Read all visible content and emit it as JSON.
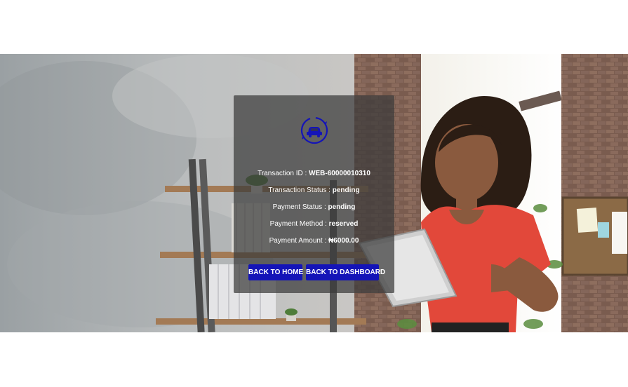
{
  "transaction": {
    "id_label": "Transaction ID :",
    "id_value": "WEB-60000010310",
    "status_label": "Transaction Status :",
    "status_value": "pending",
    "payment_status_label": "Payment Status :",
    "payment_status_value": "pending",
    "payment_method_label": "Payment Method :",
    "payment_method_value": "reserved",
    "amount_label": "Payment Amount :",
    "amount_value": "₦6000.00"
  },
  "buttons": {
    "home_label": "BACK TO HOME",
    "dashboard_label": "BACK TO DASHBOARD"
  },
  "icons": {
    "logo": "car-in-circle-icon"
  },
  "colors": {
    "button_bg": "#1414b8",
    "logo": "#1414b8",
    "card_bg": "#3a3a3a"
  }
}
